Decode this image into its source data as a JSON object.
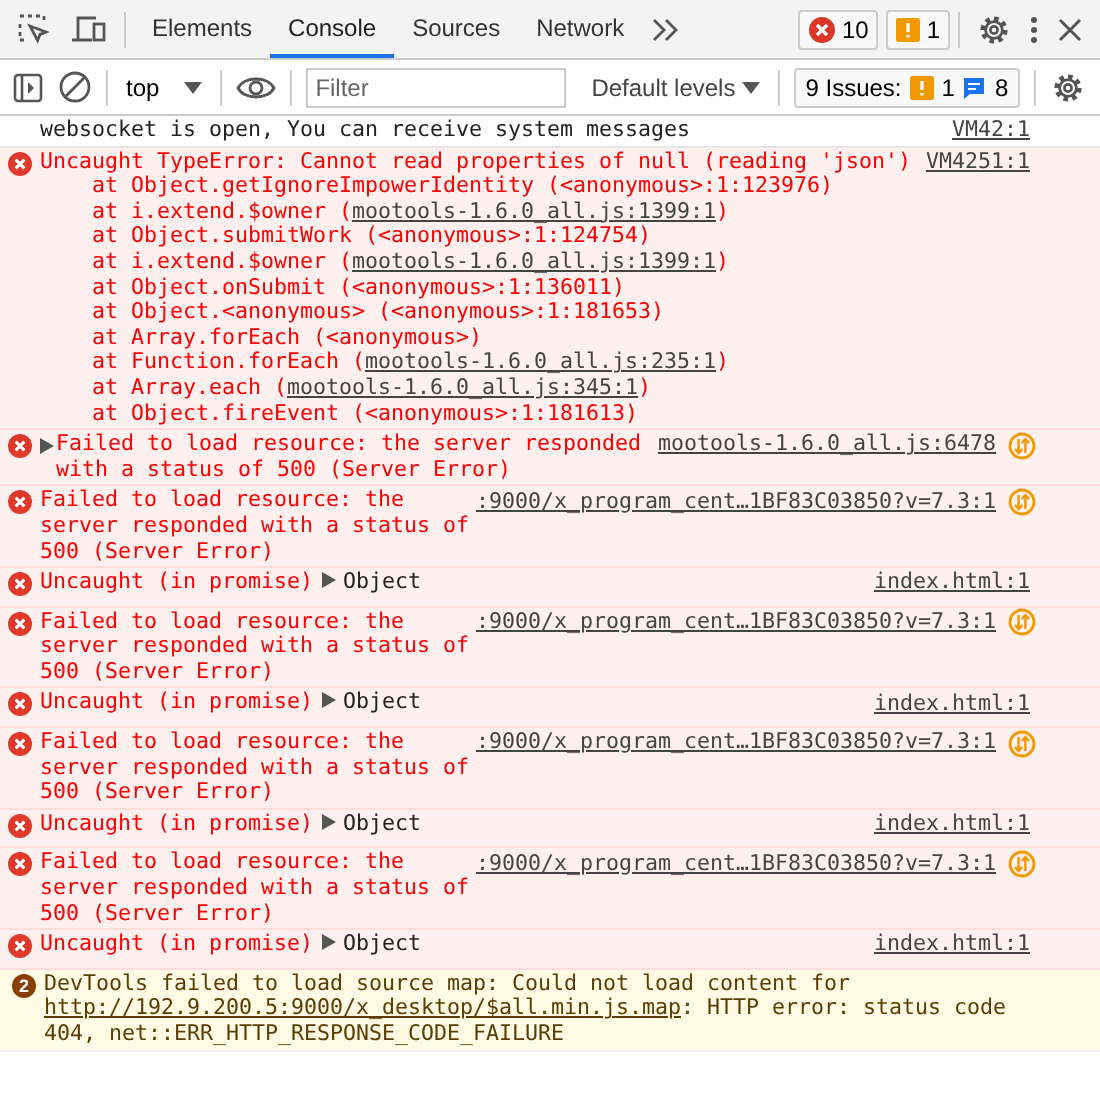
{
  "tabs": [
    {
      "label": "Elements",
      "selected": false
    },
    {
      "label": "Console",
      "selected": true
    },
    {
      "label": "Sources",
      "selected": false
    },
    {
      "label": "Network",
      "selected": false
    }
  ],
  "counts": {
    "errors": "10",
    "warnings": "1"
  },
  "toolbar": {
    "context": "top",
    "filter": {
      "placeholder": "Filter"
    },
    "levels": "Default levels",
    "issues": {
      "label": "9 Issues:",
      "warnings": "1",
      "info": "8"
    }
  },
  "messages": [
    {
      "kind": "log",
      "text": "websocket is open, You can receive system messages",
      "source": "VM42:1"
    },
    {
      "kind": "error",
      "text": "Uncaught TypeError: Cannot read properties of null (reading 'json')",
      "source": "VM4251:1",
      "stack": [
        {
          "before": "at Object.getIgnoreImpowerIdentity (<anonymous>:1:123976)"
        },
        {
          "before": "at i.extend.$owner (",
          "link": "mootools-1.6.0_all.js:1399:1",
          "after": ")"
        },
        {
          "before": "at Object.submitWork (<anonymous>:1:124754)"
        },
        {
          "before": "at i.extend.$owner (",
          "link": "mootools-1.6.0_all.js:1399:1",
          "after": ")"
        },
        {
          "before": "at Object.onSubmit (<anonymous>:1:136011)"
        },
        {
          "before": "at Object.<anonymous> (<anonymous>:1:181653)"
        },
        {
          "before": "at Array.forEach (<anonymous>)"
        },
        {
          "before": "at Function.forEach (",
          "link": "mootools-1.6.0_all.js:235:1",
          "after": ")"
        },
        {
          "before": "at Array.each (",
          "link": "mootools-1.6.0_all.js:345:1",
          "after": ")"
        },
        {
          "before": "at Object.fireEvent (<anonymous>:1:181613)"
        }
      ]
    },
    {
      "kind": "error",
      "expandable": true,
      "text": "Failed to load resource: the server responded with a status of 500 (Server Error)",
      "source": "mootools-1.6.0_all.js:6478",
      "network": true
    },
    {
      "kind": "error",
      "text": "Failed to load resource: the server responded with a status of 500 (Server Error)",
      "source": ":9000/x_program_cent…1BF83C03850?v=7.3:1",
      "network": true
    },
    {
      "kind": "error",
      "text": "Uncaught (in promise)",
      "object": "Object",
      "source": "index.html:1"
    },
    {
      "kind": "error",
      "text": "Failed to load resource: the server responded with a status of 500 (Server Error)",
      "source": ":9000/x_program_cent…1BF83C03850?v=7.3:1",
      "network": true
    },
    {
      "kind": "error",
      "text": "Uncaught (in promise)",
      "object": "Object",
      "source": "index.html:1"
    },
    {
      "kind": "error",
      "text": "Failed to load resource: the server responded with a status of 500 (Server Error)",
      "source": ":9000/x_program_cent…1BF83C03850?v=7.3:1",
      "network": true
    },
    {
      "kind": "error",
      "text": "Uncaught (in promise)",
      "object": "Object",
      "source": "index.html:1"
    },
    {
      "kind": "error",
      "text": "Failed to load resource: the server responded with a status of 500 (Server Error)",
      "source": ":9000/x_program_cent…1BF83C03850?v=7.3:1",
      "network": true
    },
    {
      "kind": "error",
      "text": "Uncaught (in promise)",
      "object": "Object",
      "source": "index.html:1"
    },
    {
      "kind": "warning",
      "repeat": "2",
      "text": "DevTools failed to load source map: Could not load content for ",
      "link": "http://192.9.200.5:9000/x_desktop/$all.min.js.map",
      "after": ": HTTP error: status code 404, net::ERR_HTTP_RESPONSE_CODE_FAILURE"
    }
  ]
}
